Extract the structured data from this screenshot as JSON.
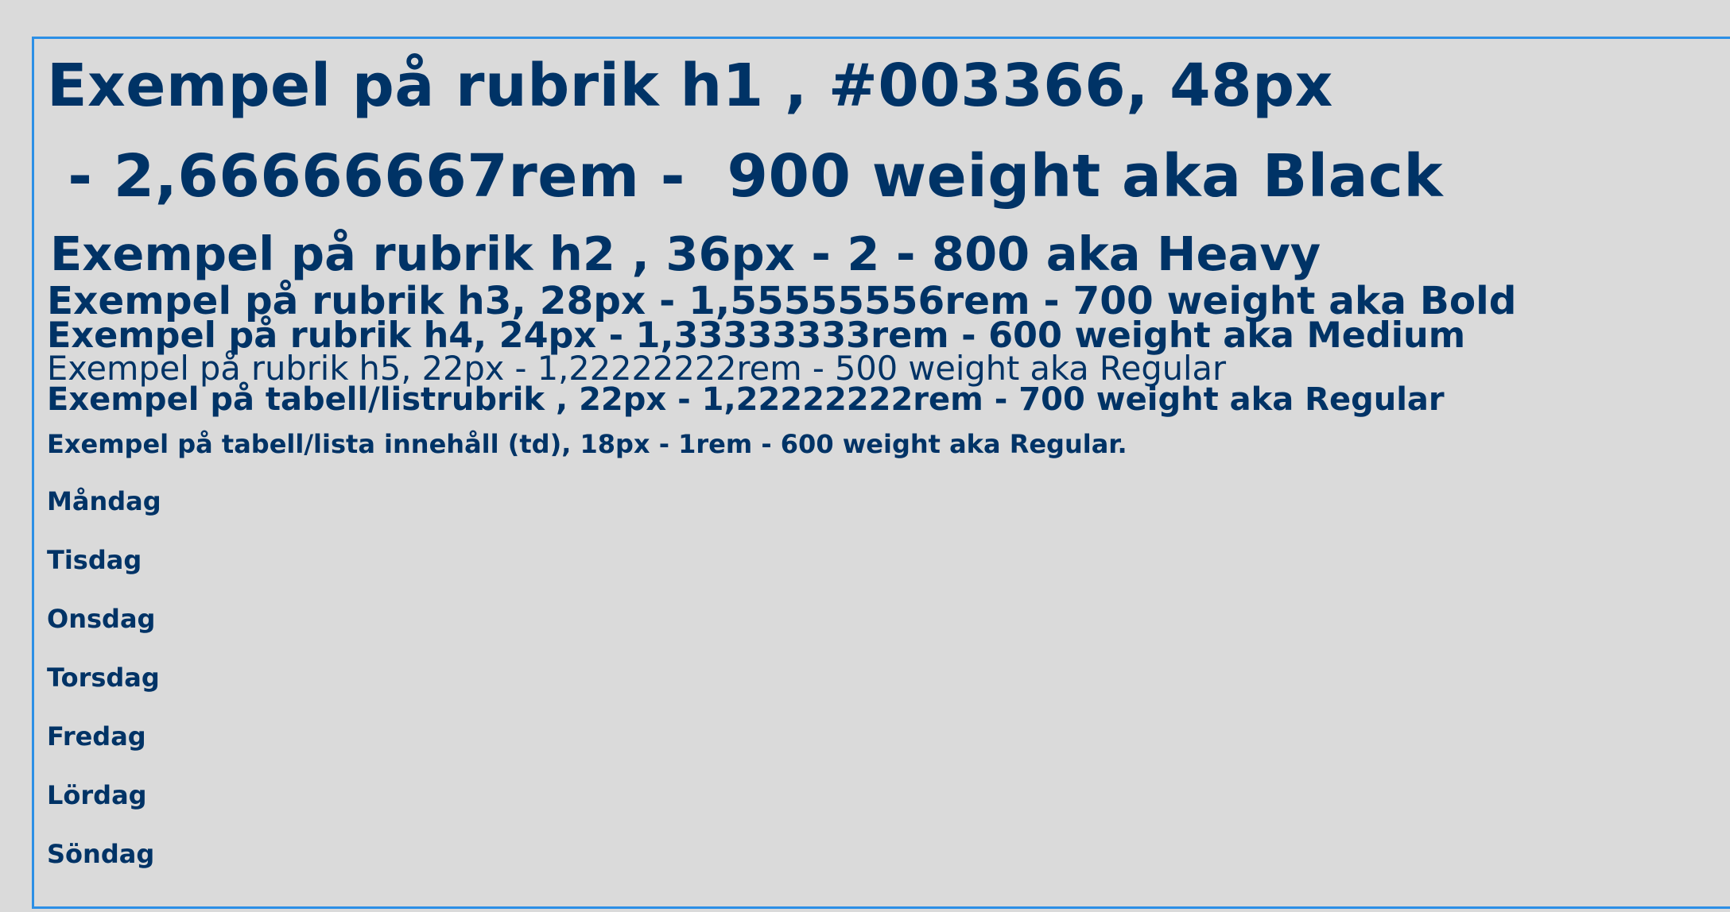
{
  "headings": {
    "h1_line1": "Exempel på rubrik h1 , #003366, 48px",
    "h1_line2": " - 2,66666667rem -  900 weight aka Black",
    "h2": "Exempel på rubrik h2 , 36px - 2 - 800 aka Heavy",
    "h3": "Exempel på rubrik h3, 28px - 1,55555556rem - 700 weight aka Bold",
    "h4": "Exempel på rubrik h4, 24px - 1,33333333rem - 600 weight aka Medium",
    "h5": "Exempel på rubrik h5, 22px - 1,22222222rem - 500 weight aka Regular"
  },
  "table": {
    "header": "Exempel på tabell/listrubrik , 22px - 1,22222222rem - 700 weight aka Regular",
    "content": "Exempel på tabell/lista innehåll (td), 18px - 1rem - 600 weight aka Regular.",
    "days": [
      "Måndag",
      "Tisdag",
      "Onsdag",
      "Torsdag",
      "Fredag",
      "Lördag",
      "Söndag"
    ]
  },
  "colors": {
    "text": "#003366",
    "frame_border": "#2b8fe6",
    "background": "#dadada"
  }
}
